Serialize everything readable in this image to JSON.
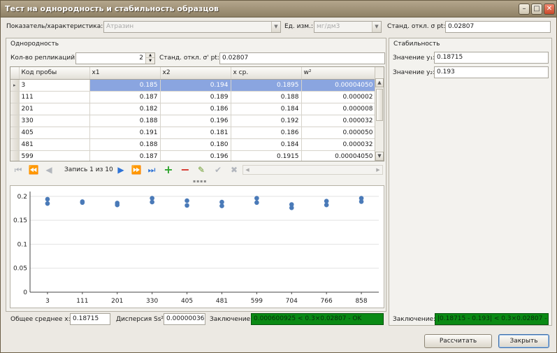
{
  "window": {
    "title": "Тест на однородность и стабильность образцов",
    "controls": {
      "minimize": "–",
      "maximize": "□",
      "close": "✕"
    }
  },
  "top": {
    "indicator_label": "Показатель/характеристика:",
    "indicator_value": "Атразин",
    "unit_label": "Ед. изм.:",
    "unit_value": "мг/дм3",
    "sigma_label": "Станд. откл. σ pt:",
    "sigma_value": "0.02807"
  },
  "homogeneity": {
    "title": "Однородность",
    "replications_label": "Кол-во репликаций:",
    "replications_value": "2",
    "sigma_label": "Станд. откл. σ' pt:",
    "sigma_value": "0.02807",
    "columns": [
      "Код пробы",
      "x1",
      "x2",
      "x ср.",
      "w²"
    ],
    "rows": [
      {
        "code": "3",
        "x1": "0.185",
        "x2": "0.194",
        "xmean": "0.1895",
        "w2": "0.00004050"
      },
      {
        "code": "111",
        "x1": "0.187",
        "x2": "0.189",
        "xmean": "0.188",
        "w2": "0.000002"
      },
      {
        "code": "201",
        "x1": "0.182",
        "x2": "0.186",
        "xmean": "0.184",
        "w2": "0.000008"
      },
      {
        "code": "330",
        "x1": "0.188",
        "x2": "0.196",
        "xmean": "0.192",
        "w2": "0.000032"
      },
      {
        "code": "405",
        "x1": "0.191",
        "x2": "0.181",
        "xmean": "0.186",
        "w2": "0.000050"
      },
      {
        "code": "481",
        "x1": "0.188",
        "x2": "0.180",
        "xmean": "0.184",
        "w2": "0.000032"
      },
      {
        "code": "599",
        "x1": "0.187",
        "x2": "0.196",
        "xmean": "0.1915",
        "w2": "0.00004050"
      }
    ],
    "navigator_text": "Запись 1 из 10",
    "overall_mean_label": "Общее среднее x:",
    "overall_mean_value": "0.18715",
    "dispersion_label": "Дисперсия Ss²:",
    "dispersion_value": "0.000000361",
    "conclusion_label": "Заключение:",
    "conclusion_value": "0.000600925 < 0.3×0.02807 - OK"
  },
  "stability": {
    "title": "Стабильность",
    "y1_label": "Значение y₁:",
    "y1_value": "0.18715",
    "y2_label": "Значение y₂:",
    "y2_value": "0.193",
    "conclusion_label": "Заключение:",
    "conclusion_value": "|0.18715 - 0.193| < 0.3×0.02807 - OK"
  },
  "buttons": {
    "calculate": "Рассчитать",
    "close": "Закрыть"
  },
  "colors": {
    "point": "#4a7ab8",
    "ok_background": "#0a8a14",
    "selection": "#8aa5e0"
  },
  "chart_data": {
    "type": "scatter",
    "categories": [
      "3",
      "111",
      "201",
      "330",
      "405",
      "481",
      "599",
      "704",
      "766",
      "858"
    ],
    "series": [
      {
        "values": [
          0.185,
          0.187,
          0.182,
          0.188,
          0.191,
          0.188,
          0.187,
          0.183,
          0.182,
          0.189
        ]
      },
      {
        "values": [
          0.194,
          0.189,
          0.186,
          0.196,
          0.181,
          0.18,
          0.196,
          0.176,
          0.19,
          0.196
        ]
      }
    ],
    "yticks": [
      "0",
      "0.05",
      "0.1",
      "0.15",
      "0.2"
    ],
    "ylim": [
      0,
      0.21
    ],
    "grid": true
  }
}
